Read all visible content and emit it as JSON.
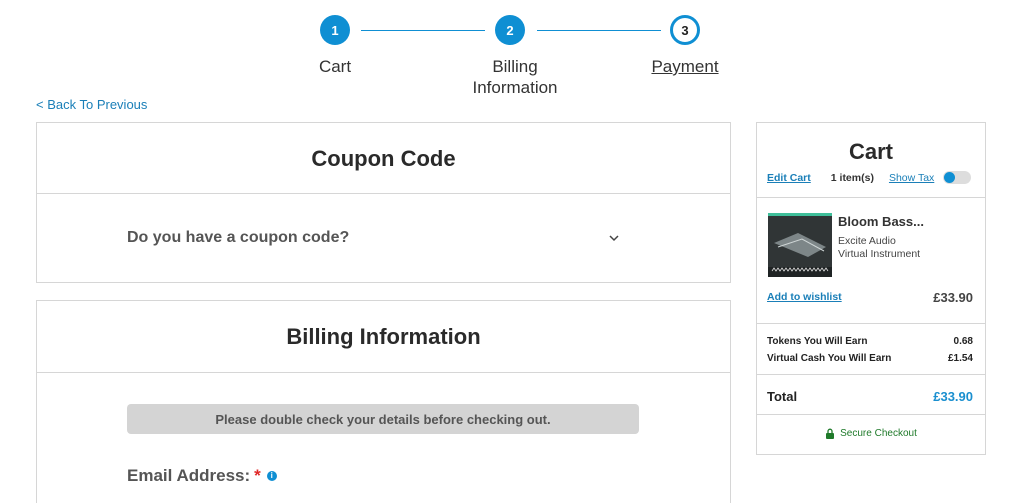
{
  "stepper": {
    "steps": [
      {
        "number": "1",
        "label": "Cart",
        "status": "done"
      },
      {
        "number": "2",
        "label_line1": "Billing",
        "label_line2": "Information",
        "status": "done"
      },
      {
        "number": "3",
        "label": "Payment",
        "status": "current"
      }
    ],
    "accent_color": "#0f8fd3"
  },
  "back_link": "< Back To Previous",
  "coupon": {
    "title": "Coupon Code",
    "question": "Do you have a coupon code?",
    "icon": "chevron-down-icon"
  },
  "billing": {
    "title": "Billing Information",
    "notice": "Please double check your details before checking out.",
    "email_label": "Email Address:",
    "required_mark": "*",
    "info_icon": "info-icon",
    "info_glyph": "i"
  },
  "cart": {
    "title": "Cart",
    "edit_label": "Edit Cart",
    "item_count": "1 item(s)",
    "show_tax_label": "Show Tax",
    "item": {
      "name": "Bloom Bass...",
      "vendor": "Excite Audio",
      "type": "Virtual Instrument",
      "wishlist_label": "Add to wishlist",
      "price": "£33.90"
    },
    "tokens_label": "Tokens You Will Earn",
    "tokens_value": "0.68",
    "cash_label": "Virtual Cash You Will Earn",
    "cash_value": "£1.54",
    "total_label": "Total",
    "total_value": "£33.90",
    "secure_label": "Secure Checkout",
    "secure_icon": "lock-icon"
  }
}
